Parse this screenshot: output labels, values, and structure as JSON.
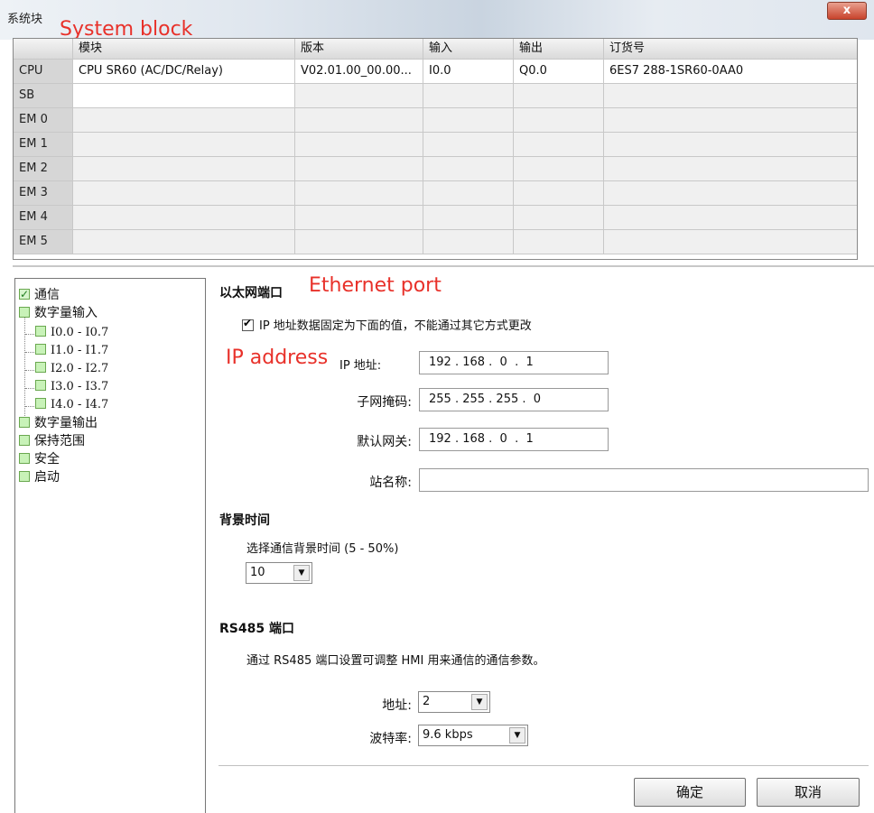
{
  "window": {
    "title": "系统块",
    "title_annotation": "System block",
    "close_label": "x"
  },
  "module_table": {
    "headers": [
      "",
      "模块",
      "版本",
      "输入",
      "输出",
      "订货号"
    ],
    "rows": [
      {
        "slot": "CPU",
        "module": "CPU SR60 (AC/DC/Relay)",
        "version": "V02.01.00_00.00...",
        "input": "I0.0",
        "output": "Q0.0",
        "order": "6ES7 288-1SR60-0AA0"
      },
      {
        "slot": "SB",
        "module": "",
        "version": "",
        "input": "",
        "output": "",
        "order": ""
      },
      {
        "slot": "EM 0",
        "module": "",
        "version": "",
        "input": "",
        "output": "",
        "order": ""
      },
      {
        "slot": "EM 1",
        "module": "",
        "version": "",
        "input": "",
        "output": "",
        "order": ""
      },
      {
        "slot": "EM 2",
        "module": "",
        "version": "",
        "input": "",
        "output": "",
        "order": ""
      },
      {
        "slot": "EM 3",
        "module": "",
        "version": "",
        "input": "",
        "output": "",
        "order": ""
      },
      {
        "slot": "EM 4",
        "module": "",
        "version": "",
        "input": "",
        "output": "",
        "order": ""
      },
      {
        "slot": "EM 5",
        "module": "",
        "version": "",
        "input": "",
        "output": "",
        "order": ""
      }
    ]
  },
  "tree": {
    "items": [
      "通信",
      "数字量输入",
      "I0.0 - I0.7",
      "I1.0 - I1.7",
      "I2.0 - I2.7",
      "I3.0 - I3.7",
      "I4.0 - I4.7",
      "数字量输出",
      "保持范围",
      "安全",
      "启动"
    ]
  },
  "ethernet": {
    "title": "以太网端口",
    "annotation": "Ethernet port",
    "fixed_ip_label": "IP 地址数据固定为下面的值，不能通过其它方式更改",
    "ip_annotation": "IP address",
    "ip_label": "IP 地址:",
    "ip_value": "192 . 168 .  0  .  1",
    "subnet_label": "子网掩码:",
    "subnet_value": "255 . 255 . 255 .  0",
    "gateway_label": "默认网关:",
    "gateway_value": "192 . 168 .  0  .  1",
    "station_label": "站名称:",
    "station_value": ""
  },
  "background_time": {
    "title": "背景时间",
    "prompt": "选择通信背景时间 (5 - 50%)",
    "value": "10"
  },
  "rs485": {
    "title": "RS485 端口",
    "description": "通过 RS485 端口设置可调整 HMI 用来通信的通信参数。",
    "address_label": "地址:",
    "address_value": "2",
    "baud_label": "波特率:",
    "baud_value": "9.6 kbps"
  },
  "buttons": {
    "ok": "确定",
    "cancel": "取消"
  }
}
